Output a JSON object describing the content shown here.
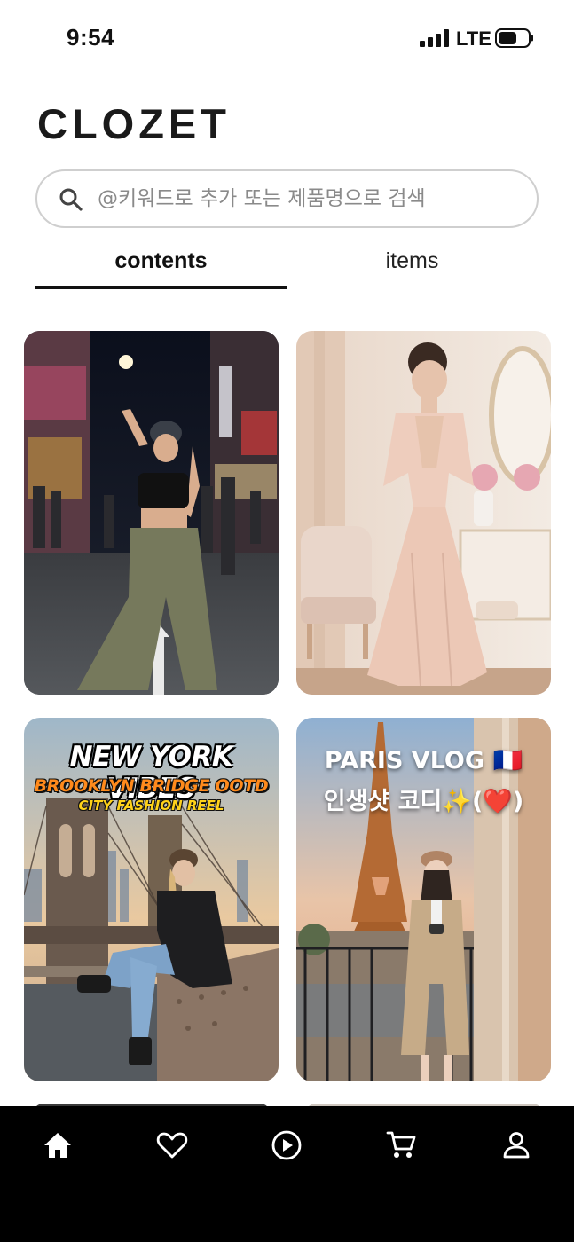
{
  "status_bar": {
    "time": "9:54",
    "network": "LTE"
  },
  "header": {
    "app_title": "CLOZET"
  },
  "search": {
    "placeholder": "@키워드로 추가 또는 제품명으로 검색",
    "icon": "search-icon"
  },
  "tabs": [
    {
      "label": "contents",
      "active": true
    },
    {
      "label": "items",
      "active": false
    }
  ],
  "feed": {
    "cards": [
      {
        "type": "photo",
        "overlay_lines": []
      },
      {
        "type": "photo",
        "overlay_lines": []
      },
      {
        "type": "photo",
        "overlay_lines": [
          "NEW YORK VIBES",
          "BROOKLYN BRIDGE OOTD",
          "CITY FASHION REEL"
        ]
      },
      {
        "type": "photo",
        "overlay_lines": [
          "PARIS VLOG 🇫🇷",
          "인생샷 코디✨(❤️)"
        ]
      }
    ]
  },
  "bottom_nav": {
    "items": [
      {
        "icon": "home-icon",
        "active": true
      },
      {
        "icon": "heart-icon",
        "active": false
      },
      {
        "icon": "play-icon",
        "active": false
      },
      {
        "icon": "cart-icon",
        "active": false
      },
      {
        "icon": "profile-icon",
        "active": false
      }
    ]
  },
  "colors": {
    "background": "#ffffff",
    "text_primary": "#111111",
    "nav_background": "#000000",
    "nav_icon": "#ffffff",
    "search_border": "#cfcfcf",
    "placeholder": "#8a8a8a"
  }
}
